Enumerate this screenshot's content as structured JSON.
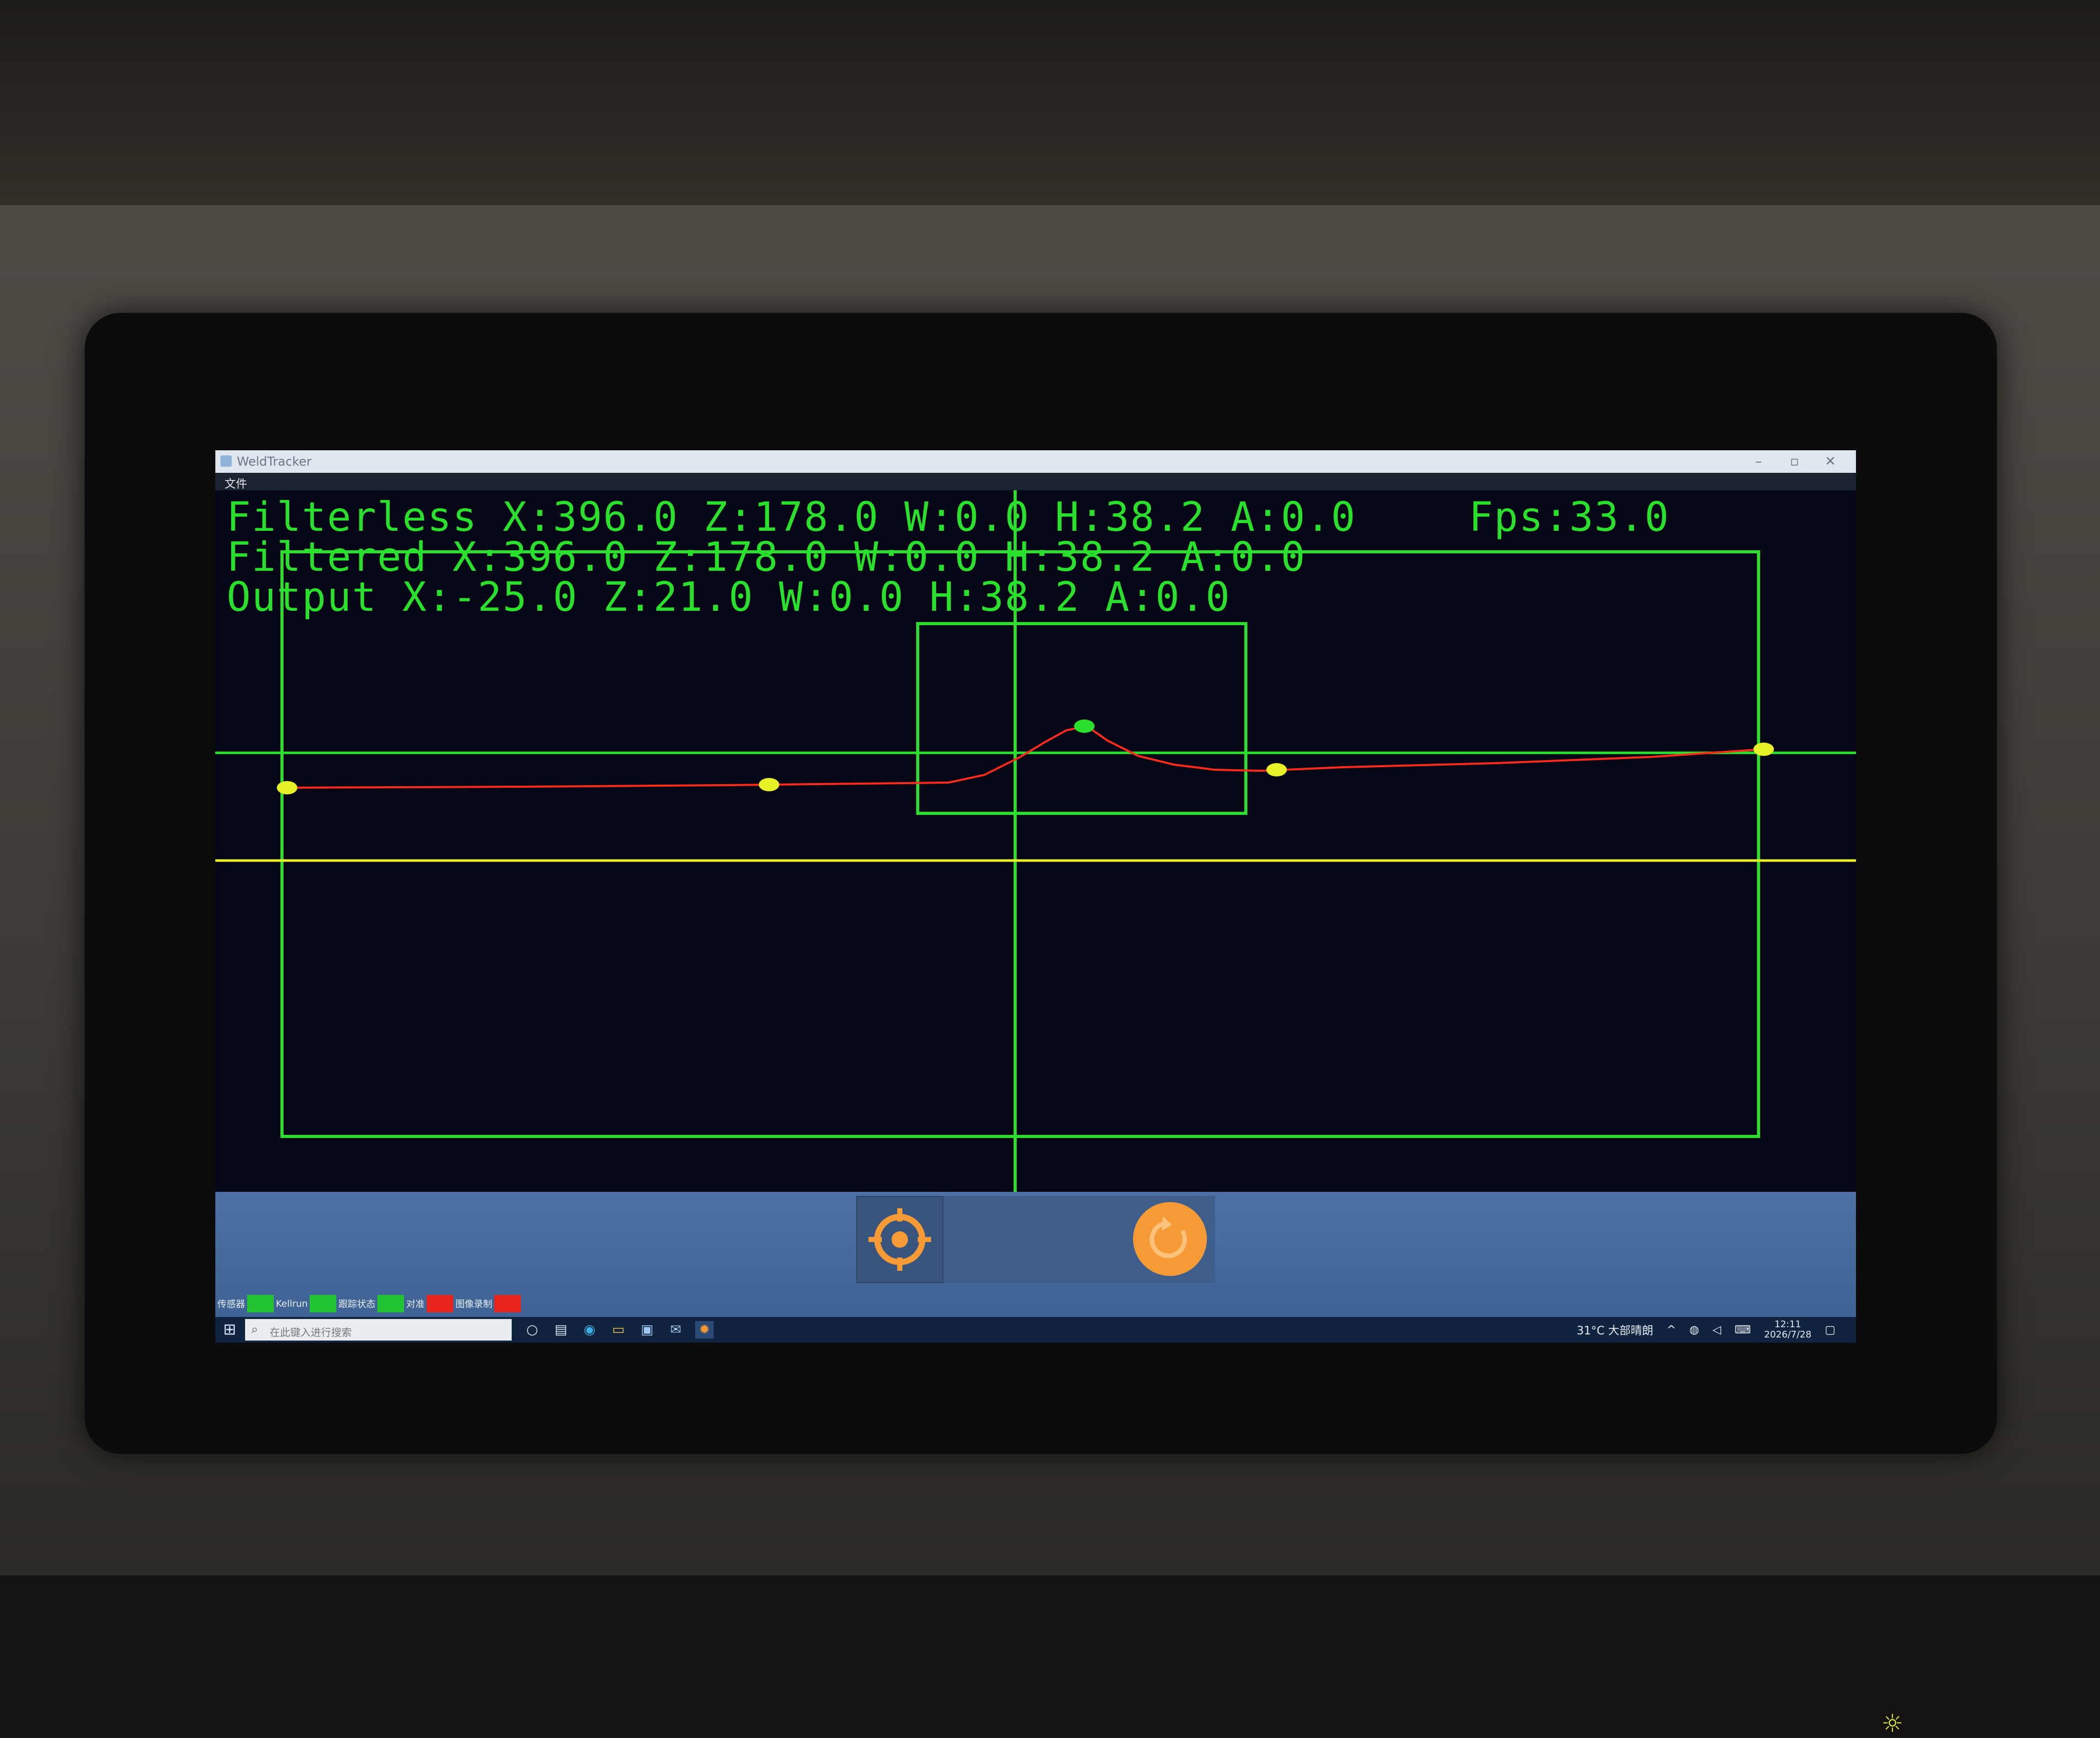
{
  "window": {
    "title": "WeldTracker",
    "menu": {
      "file": "文件"
    },
    "minimize_icon": "minimize-icon",
    "maximize_icon": "maximize-icon",
    "close_icon": "close-icon"
  },
  "readout": {
    "filterless": "Filterless X:396.0 Z:178.0 W:0.0 H:38.2 A:0.0",
    "fps": "Fps:33.0",
    "filtered": "Filtered X:396.0 Z:178.0 W:0.0 H:38.2 A:0.0",
    "output": "Output X:-25.0 Z:21.0 W:0.0 H:38.2 A:0.0"
  },
  "colors": {
    "overlay_green": "#29e02c",
    "profile_red": "#ff2a1e",
    "marker_yellow": "#e8f028",
    "view_bg": "#050616",
    "status_ok": "#22c531",
    "status_off": "#e8231b",
    "button_orange": "#f59a34"
  },
  "controls": {
    "target_icon": "crosshair-target-icon",
    "reset_icon": "reset-rotate-icon"
  },
  "status": [
    {
      "label": "传感器",
      "state": "ok"
    },
    {
      "label": "Kellrun",
      "state": "ok"
    },
    {
      "label": "跟踪状态",
      "state": "ok"
    },
    {
      "label": "对准",
      "state": "off"
    },
    {
      "label": "图像录制",
      "state": "off"
    }
  ],
  "taskbar": {
    "search_placeholder": "在此键入进行搜索",
    "weather": "31°C 大部晴朗",
    "time": "12:11",
    "date": "2026/7/28",
    "start_icon": "windows-start-icon",
    "apps": [
      "cortana-icon",
      "task-view-icon",
      "edge-icon",
      "file-explorer-icon",
      "store-icon",
      "mail-icon",
      "weldtracker-app-icon"
    ]
  }
}
